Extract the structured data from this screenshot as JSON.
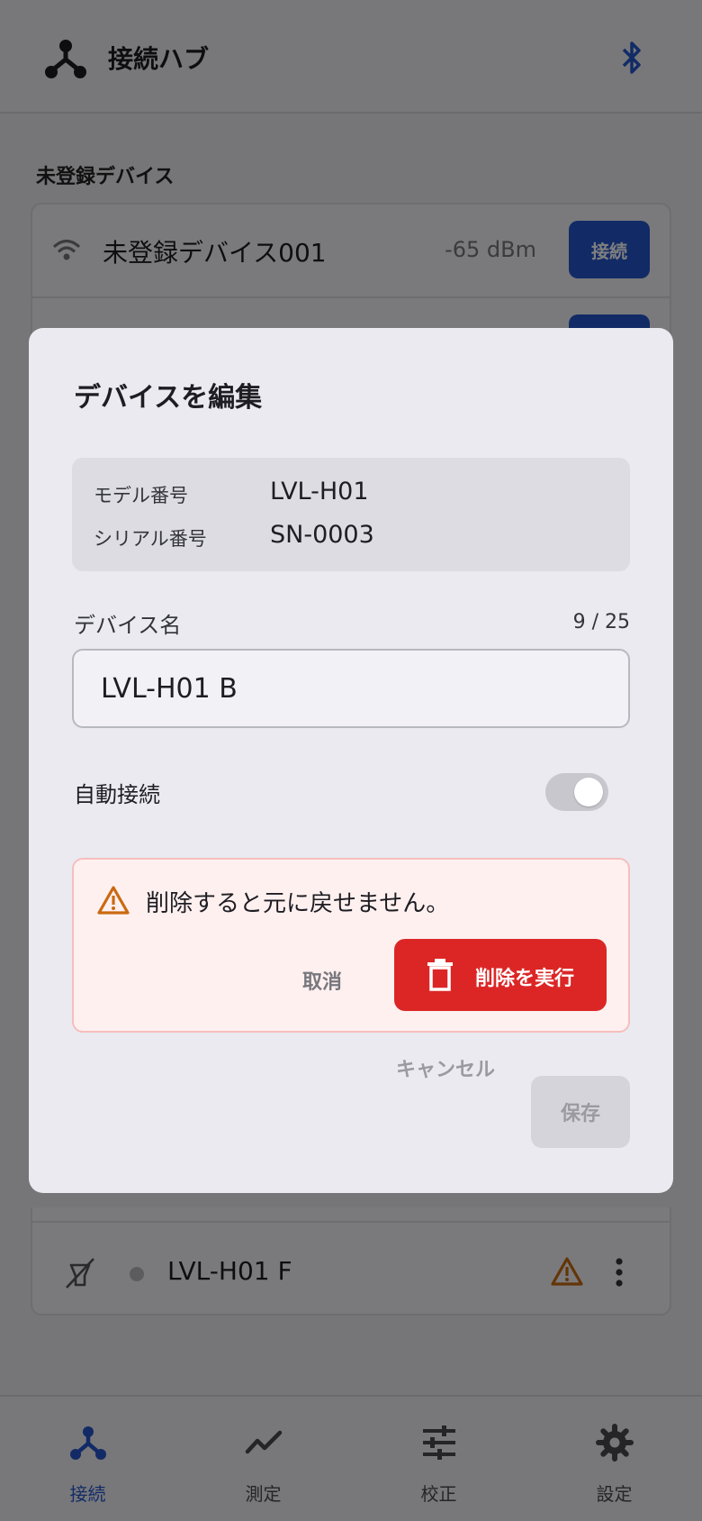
{
  "app": {
    "title": "接続ハブ",
    "section_unregistered": "未登録デバイス",
    "unregistered_devices": [
      {
        "name": "未登録デバイス001",
        "rssi": "-65 dBm",
        "connect_label": "接続"
      }
    ],
    "registered_device": {
      "name": "LVL-H01 F",
      "status": "disconnected"
    },
    "tabs": [
      {
        "label": "接続",
        "icon": "hub-icon",
        "active": true
      },
      {
        "label": "測定",
        "icon": "chart-line-icon",
        "active": false
      },
      {
        "label": "校正",
        "icon": "sliders-icon",
        "active": false
      },
      {
        "label": "設定",
        "icon": "gear-icon",
        "active": false
      }
    ],
    "colors": {
      "accent": "#2457cc",
      "danger": "#dc2626",
      "warning": "#c96a10"
    }
  },
  "modal": {
    "title": "デバイスを編集",
    "model_label": "モデル番号",
    "model_value": "LVL-H01",
    "serial_label": "シリアル番号",
    "serial_value": "SN-0003",
    "name_label": "デバイス名",
    "name_counter": "9 / 25",
    "name_value": "LVL-H01 B",
    "auto_connect_label": "自動接続",
    "auto_connect_on": true,
    "delete_warning": "削除すると元に戻せません。",
    "undo_label": "取消",
    "delete_label": "削除を実行",
    "cancel_label": "キャンセル",
    "save_label": "保存"
  }
}
